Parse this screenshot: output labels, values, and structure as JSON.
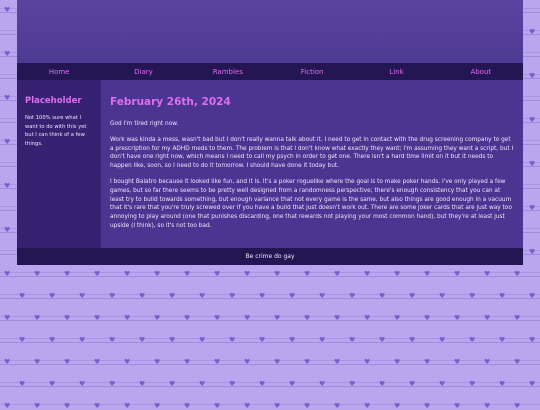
{
  "nav": {
    "items": [
      "Home",
      "Diary",
      "Rambles",
      "Fiction",
      "Link",
      "About"
    ]
  },
  "sidebar": {
    "title": "Placeholder",
    "text": "Not 100% sure what I want to do with this yet but I can think of a few things."
  },
  "post": {
    "date": "February 26th, 2024",
    "paragraphs": [
      "God I'm tired right now.",
      "Work was kinda a mess, wasn't bad but I don't really wanna talk about it. I need to get in contact with the drug screening company to get a prescription for my ADHD meds to them. The problem is that I don't know what exactly they want; I'm assuming they want a script, but I don't have one right now, which means I need to call my psych in order to get one. There isn't a hard time limit on it but it needs to happen like, soon, so I need to do it tomorrow. I should have done it today but.",
      "I bought Balatro because it looked like fun, and it is. It's a poker roguelike where the goal is to make poker hands. I've only played a few games, but so far there seems to be pretty well designed from a randomness perspective; there's enough consistency that you can at least try to build towards something, but enough variance that not every game is the same, but also things are good enough in a vacuum that it's rare that you're truly screwed over if you have a build that just doesn't work out. There are some joker cards that are just way too annoying to play around (one that punishes discarding, one that rewards not playing your most common hand), but they're at least just upside (I think), so it's not too bad."
    ]
  },
  "footer": {
    "text": "Be crime do gay"
  },
  "colors": {
    "accent": "#e06df0",
    "background": "#b8a6ee",
    "panel_dark": "#241652",
    "panel_main": "#4a3590",
    "panel_side": "#352270",
    "text": "#f0e8ff"
  }
}
